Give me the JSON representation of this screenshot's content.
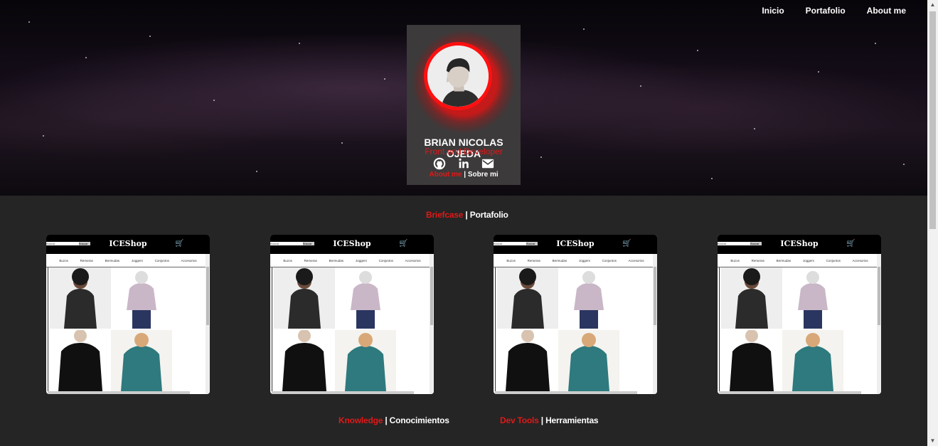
{
  "nav": {
    "items": [
      "Inicio",
      "Portafolio",
      "About me"
    ]
  },
  "profile": {
    "name": "BRIAN NICOLAS OJEDA",
    "role": "Front end Developer",
    "socials": [
      "github-icon",
      "linkedin-icon",
      "mail-icon"
    ],
    "about_en": "About me",
    "sep": " | ",
    "about_es": "Sobre mi"
  },
  "portfolio": {
    "title_en": "Briefcase",
    "sep": " | ",
    "title_es": "Portafolio",
    "projects": [
      {
        "brand": "ICEShop",
        "search_placeholder": "Buscar",
        "search_button": "Buscar",
        "menu": [
          "Buzos",
          "Remeras",
          "Bermudas",
          "Joggers",
          "Conjuntos",
          "Accesorios"
        ]
      },
      {
        "brand": "ICEShop",
        "search_placeholder": "Buscar",
        "search_button": "Buscar",
        "menu": [
          "Buzos",
          "Remeras",
          "Bermudas",
          "Joggers",
          "Conjuntos",
          "Accesorios"
        ]
      },
      {
        "brand": "ICEShop",
        "search_placeholder": "Buscar",
        "search_button": "Buscar",
        "menu": [
          "Buzos",
          "Remeras",
          "Bermudas",
          "Joggers",
          "Conjuntos",
          "Accesorios"
        ]
      },
      {
        "brand": "ICEShop",
        "search_placeholder": "Buscar",
        "search_button": "Buscar",
        "menu": [
          "Buzos",
          "Remeras",
          "Bermudas",
          "Joggers",
          "Conjuntos",
          "Accesorios"
        ]
      }
    ]
  },
  "knowledge": {
    "title_en": "Knowledge",
    "sep": " | ",
    "title_es": "Conocimientos"
  },
  "devtools": {
    "title_en": "Dev Tools",
    "sep": " | ",
    "title_es": "Herramientas"
  },
  "colors": {
    "accent": "#e01818",
    "background": "#252525",
    "card": "#3c3a3b"
  }
}
